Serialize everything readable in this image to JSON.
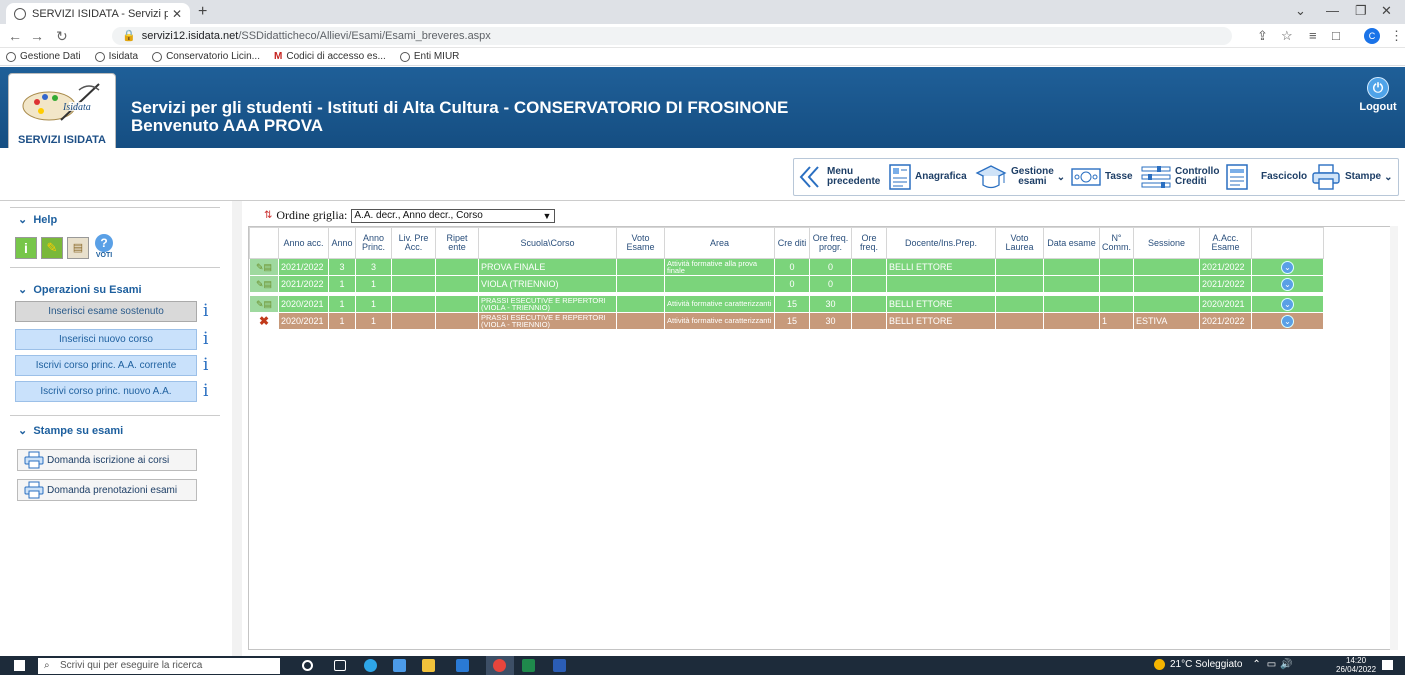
{
  "browser": {
    "tab_title": "SERVIZI ISIDATA - Servizi per gli",
    "url_host": "servizi12.isidata.net",
    "url_path": "/SSDidatticheco/Allievi/Esami/Esami_breveres.aspx",
    "profile_letter": "C",
    "bookmarks": [
      "Gestione Dati",
      "Isidata",
      "Conservatorio Licin...",
      "Codici di accesso es...",
      "Enti MIUR"
    ]
  },
  "header": {
    "logo_caption": "SERVIZI ISIDATA",
    "title_line1": "Servizi per gli studenti - Istituti di Alta Cultura - CONSERVATORIO DI FROSINONE",
    "title_line2": "Benvenuto AAA PROVA",
    "logout_label": "Logout",
    "bg_color": "#1a5791"
  },
  "menu": {
    "items": [
      {
        "label1": "Menu",
        "label2": "precedente",
        "icon": "double-chevron-left-icon"
      },
      {
        "label1": "Anagrafica",
        "label2": "",
        "icon": "id-card-icon"
      },
      {
        "label1": "Gestione",
        "label2": "esami",
        "icon": "graduation-cap-icon",
        "dropdown": true
      },
      {
        "label1": "Tasse",
        "label2": "",
        "icon": "money-icon"
      },
      {
        "label1": "Controllo",
        "label2": "Crediti",
        "icon": "sliders-icon"
      },
      {
        "label1": "Fascicolo",
        "label2": "",
        "icon": "folder-icon"
      },
      {
        "label1": "Stampe",
        "label2": "",
        "icon": "printer-icon",
        "dropdown": true
      }
    ]
  },
  "sidebar": {
    "help_title": "Help",
    "help_voti_label": "VOTI",
    "ops_title": "Operazioni su Esami",
    "ops": [
      {
        "label": "Inserisci esame sostenuto",
        "style": "gray"
      },
      {
        "label": "Inserisci nuovo corso",
        "style": "blue"
      },
      {
        "label": "Iscrivi corso princ. A.A. corrente",
        "style": "blue"
      },
      {
        "label": "Iscrivi corso princ. nuovo A.A.",
        "style": "blue"
      }
    ],
    "prints_title": "Stampe su esami",
    "prints": [
      "Domanda iscrizione ai corsi",
      "Domanda prenotazioni esami"
    ]
  },
  "grid": {
    "order_label": "Ordine griglia:",
    "order_value": "A.A. decr., Anno decr., Corso",
    "columns": [
      "",
      "Anno acc.",
      "Anno",
      "Anno Princ.",
      "Liv. Pre Acc.",
      "Ripet ente",
      "Scuola\\Corso",
      "Voto Esame",
      "Area",
      "Cre diti",
      "Ore freq. progr.",
      "Ore freq.",
      "Docente/Ins.Prep.",
      "Voto Laurea",
      "Data esame",
      "N° Comm.",
      "Sessione",
      "A.Acc. Esame",
      ""
    ],
    "rows": [
      {
        "status": "green",
        "icon": "pen",
        "cells": [
          "2021/2022",
          "3",
          "3",
          "",
          "",
          "PROVA FINALE",
          "",
          "Attività formative alla prova finale",
          "0",
          "0",
          "",
          "BELLI ETTORE",
          "",
          "",
          "",
          "",
          "2021/2022"
        ]
      },
      {
        "status": "green",
        "icon": "pen",
        "cells": [
          "2021/2022",
          "1",
          "1",
          "",
          "",
          "VIOLA (TRIENNIO)",
          "",
          "",
          "0",
          "0",
          "",
          "",
          "",
          "",
          "",
          "",
          "2021/2022"
        ]
      },
      {
        "status": "green",
        "icon": "pen",
        "cells": [
          "2020/2021",
          "1",
          "1",
          "",
          "",
          "PRASSI ESECUTIVE E REPERTORI (VIOLA - TRIENNIO)",
          "",
          "Attività formative caratterizzanti",
          "15",
          "30",
          "",
          "BELLI ETTORE",
          "",
          "",
          "",
          "",
          "2020/2021"
        ]
      },
      {
        "status": "brown",
        "icon": "cross",
        "cells": [
          "2020/2021",
          "1",
          "1",
          "",
          "",
          "PRASSI ESECUTIVE E REPERTORI (VIOLA - TRIENNIO)",
          "",
          "Attività formative caratterizzanti",
          "15",
          "30",
          "",
          "BELLI ETTORE",
          "",
          "",
          "1",
          "ESTIVA",
          "2021/2022"
        ]
      }
    ],
    "colors": {
      "passed": "#7bd47b",
      "failed": "#c79a7b"
    }
  },
  "taskbar": {
    "search_placeholder": "Scrivi qui per eseguire la ricerca",
    "weather": "21°C Soleggiato",
    "time": "14:20",
    "date": "26/04/2022"
  }
}
